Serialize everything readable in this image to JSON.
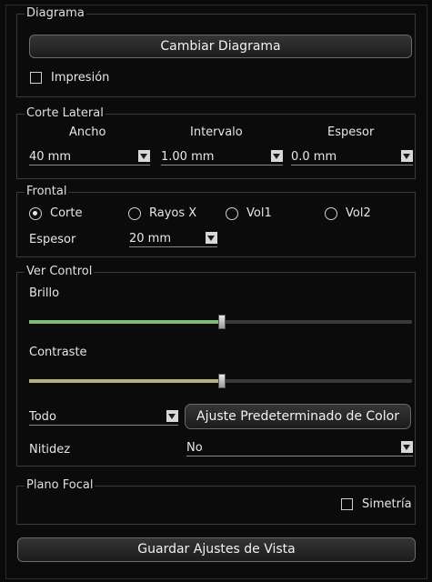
{
  "diagram": {
    "legend": "Diagrama",
    "change_button": "Cambiar Diagrama",
    "print_label": "Impresión",
    "print_checked": false
  },
  "lateral": {
    "legend": "Corte Lateral",
    "col_width": "Ancho",
    "col_interval": "Intervalo",
    "col_thickness": "Espesor",
    "width_value": "40 mm",
    "interval_value": "1.00 mm",
    "thickness_value": "0.0 mm"
  },
  "frontal": {
    "legend": "Frontal",
    "options": [
      "Corte",
      "Rayos X",
      "Vol1",
      "Vol2"
    ],
    "selected": "Corte",
    "thickness_label": "Espesor",
    "thickness_value": "20 mm"
  },
  "view": {
    "legend": "Ver Control",
    "brightness_label": "Brillo",
    "brightness_fraction": 0.5,
    "brightness_color": "#7fb77a",
    "contrast_label": "Contraste",
    "contrast_fraction": 0.5,
    "contrast_color": "#b8b27a",
    "channel_value": "Todo",
    "preset_button": "Ajuste Predeterminado de Color",
    "sharpness_label": "Nitidez",
    "sharpness_value": "No"
  },
  "focal": {
    "legend": "Plano Focal",
    "symmetry_label": "Simetría",
    "symmetry_checked": false
  },
  "save_button": "Guardar Ajustes de Vista"
}
